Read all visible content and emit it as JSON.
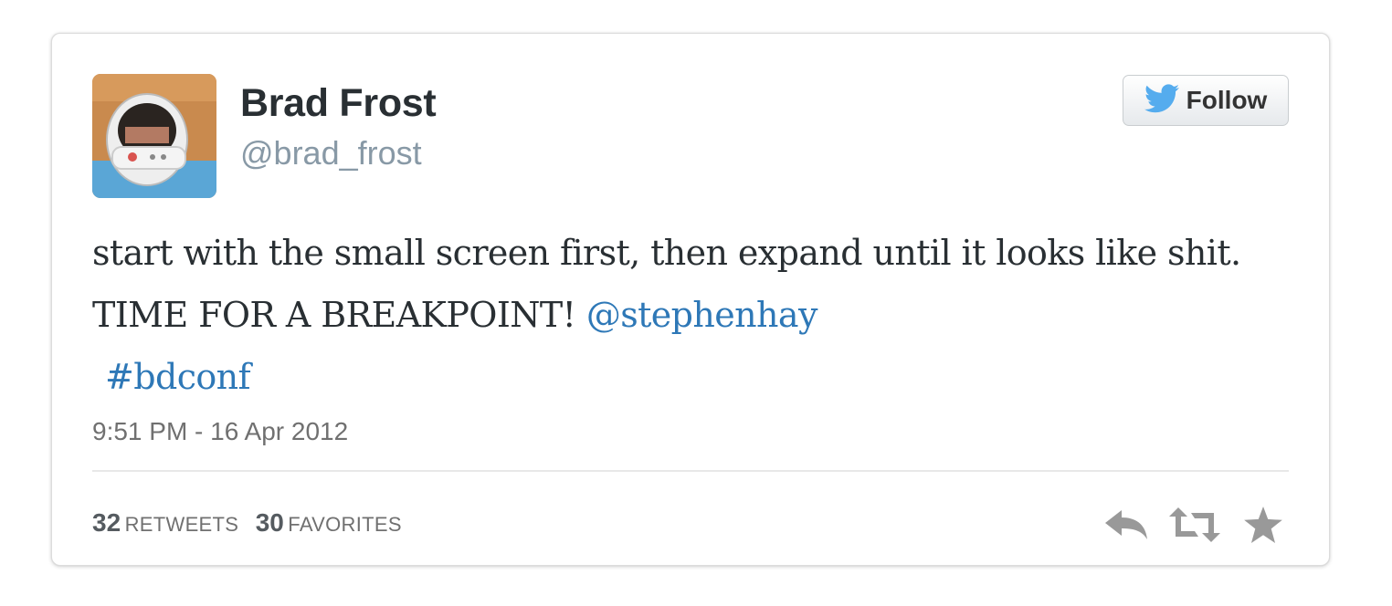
{
  "tweet": {
    "author": {
      "display_name": "Brad Frost",
      "handle": "@brad_frost"
    },
    "follow_button": {
      "label": "Follow",
      "icon": "twitter-bird-icon"
    },
    "text": {
      "body": "start with the small screen first, then expand until it looks like shit. TIME FOR A BREAKPOINT!",
      "mention": "@stephenhay",
      "hashtag": "#bdconf"
    },
    "timestamp": "9:51 PM - 16 Apr 2012",
    "stats": {
      "retweets_count": "32",
      "retweets_label": "RETWEETS",
      "favorites_count": "30",
      "favorites_label": "FAVORITES"
    },
    "actions": [
      {
        "icon": "reply-icon"
      },
      {
        "icon": "retweet-icon"
      },
      {
        "icon": "favorite-star-icon"
      }
    ],
    "colors": {
      "link": "#2e78b7",
      "twitter_blue": "#55acee",
      "icon_gray": "#999999"
    }
  }
}
